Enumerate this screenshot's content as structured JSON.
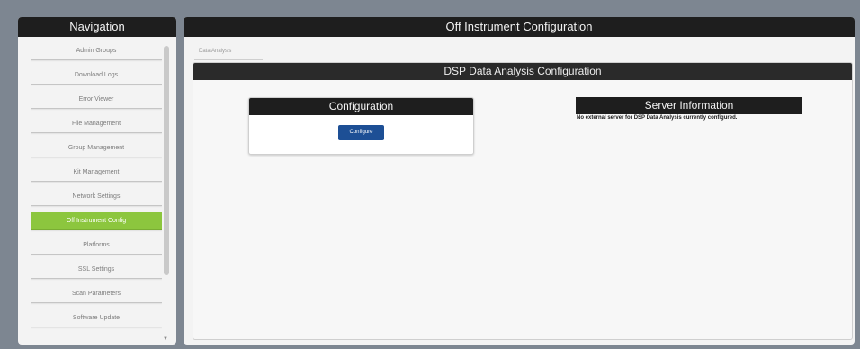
{
  "navigation": {
    "title": "Navigation",
    "items": [
      {
        "label": "Admin Groups",
        "active": false
      },
      {
        "label": "Download Logs",
        "active": false
      },
      {
        "label": "Error Viewer",
        "active": false
      },
      {
        "label": "File Management",
        "active": false
      },
      {
        "label": "Group Management",
        "active": false
      },
      {
        "label": "Kit Management",
        "active": false
      },
      {
        "label": "Network Settings",
        "active": false
      },
      {
        "label": "Off Instrument Config",
        "active": true
      },
      {
        "label": "Platforms",
        "active": false
      },
      {
        "label": "SSL Settings",
        "active": false
      },
      {
        "label": "Scan Parameters",
        "active": false
      },
      {
        "label": "Software Update",
        "active": false
      }
    ],
    "active_color": "#8cc63e"
  },
  "main": {
    "title": "Off Instrument Configuration",
    "tab_label": "Data Analysis",
    "section_title": "DSP Data Analysis Configuration",
    "configuration": {
      "title": "Configuration",
      "button_label": "Configure",
      "button_color": "#1d4f95"
    },
    "server_information": {
      "title": "Server Information",
      "message": "No external server for DSP Data Analysis currently configured."
    }
  }
}
